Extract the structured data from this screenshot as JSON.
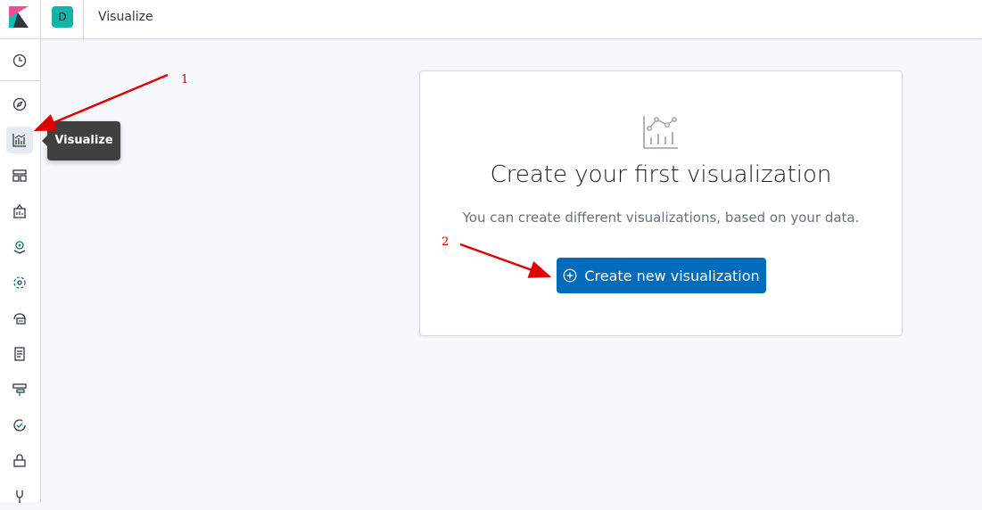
{
  "header": {
    "space_initial": "D",
    "breadcrumb": "Visualize"
  },
  "sidenav": {
    "items": [
      {
        "name": "recently-viewed",
        "icon": "clock-icon"
      },
      {
        "name": "discover",
        "icon": "compass-icon"
      },
      {
        "name": "visualize",
        "icon": "visualize-chart-icon",
        "active": true
      },
      {
        "name": "dashboard",
        "icon": "dashboard-icon"
      },
      {
        "name": "canvas",
        "icon": "canvas-icon"
      },
      {
        "name": "maps",
        "icon": "map-pin-icon"
      },
      {
        "name": "machine-learning",
        "icon": "ml-icon"
      },
      {
        "name": "infrastructure",
        "icon": "infra-icon"
      },
      {
        "name": "logs",
        "icon": "logs-icon"
      },
      {
        "name": "apm",
        "icon": "apm-icon"
      },
      {
        "name": "uptime",
        "icon": "uptime-icon"
      },
      {
        "name": "siem",
        "icon": "siem-icon"
      },
      {
        "name": "dev-tools",
        "icon": "wrench-icon"
      }
    ]
  },
  "tooltip": {
    "text": "Visualize"
  },
  "empty_state": {
    "title": "Create your first visualization",
    "description": "You can create different visualizations, based on your data.",
    "button_label": "Create new visualization"
  },
  "annotations": {
    "label_1": "1",
    "label_2": "2"
  },
  "colors": {
    "primary": "#006bb8",
    "space_avatar": "#13b5a8",
    "annotation": "#e00000"
  }
}
